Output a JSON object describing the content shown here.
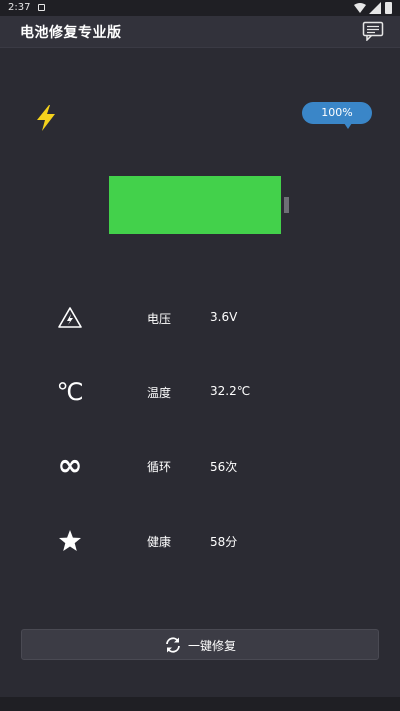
{
  "status_bar": {
    "time": "2:37"
  },
  "app_bar": {
    "title": "电池修复专业版",
    "message_icon": "message-icon"
  },
  "battery": {
    "percent_label": "100%",
    "level": 1.0,
    "fill_color": "#43d14b",
    "bubble_color": "#3a86c8"
  },
  "stats": [
    {
      "icon": "voltage-warning-icon",
      "label": "电压",
      "value": "3.6V"
    },
    {
      "icon": "celsius-icon",
      "label": "温度",
      "value": "32.2℃",
      "icon_text": "℃"
    },
    {
      "icon": "infinity-icon",
      "label": "循环",
      "value": "56次",
      "icon_text": "∞"
    },
    {
      "icon": "star-icon",
      "label": "健康",
      "value": "58分"
    }
  ],
  "repair_button": {
    "label": "一键修复",
    "icon": "refresh-icon"
  }
}
